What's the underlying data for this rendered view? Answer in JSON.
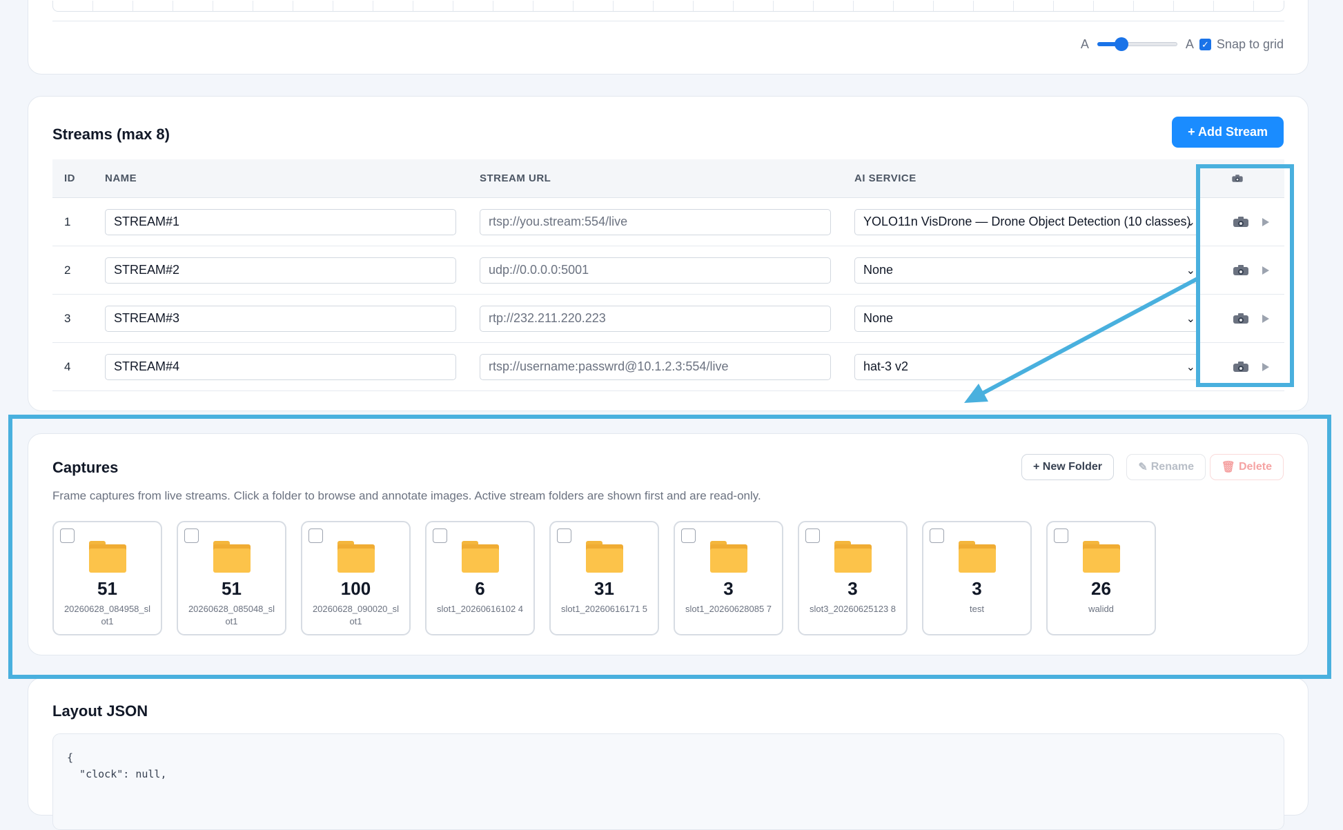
{
  "grid_controls": {
    "label_left": "A",
    "label_right": "A",
    "slider_level": 0.3,
    "snap_label": "Snap to grid",
    "snap_checked": true
  },
  "streams": {
    "title": "Streams (max 8)",
    "add_button": "+ Add Stream",
    "headers": {
      "id": "ID",
      "name": "NAME",
      "url": "STREAM URL",
      "ai": "AI SERVICE"
    },
    "rows": [
      {
        "id": "1",
        "name": "STREAM#1",
        "url": "rtsp://you.stream:554/live",
        "ai": "YOLO11n VisDrone — Drone Object Detection (10 classes)"
      },
      {
        "id": "2",
        "name": "STREAM#2",
        "url": "udp://0.0.0.0:5001",
        "ai": "None"
      },
      {
        "id": "3",
        "name": "STREAM#3",
        "url": "rtp://232.211.220.223",
        "ai": "None"
      },
      {
        "id": "4",
        "name": "STREAM#4",
        "url": "rtsp://username:passwrd@10.1.2.3:554/live",
        "ai": "hat-3 v2"
      }
    ]
  },
  "captures": {
    "title": "Captures",
    "description": "Frame captures from live streams. Click a folder to browse and annotate images. Active stream folders are shown first and are read-only.",
    "new_folder": "+ New Folder",
    "rename": "Rename",
    "delete": "Delete",
    "folders": [
      {
        "count": "51",
        "name": "20260628_084958_slot1"
      },
      {
        "count": "51",
        "name": "20260628_085048_slot1"
      },
      {
        "count": "100",
        "name": "20260628_090020_slot1"
      },
      {
        "count": "6",
        "name": "slot1_20260616102 4"
      },
      {
        "count": "31",
        "name": "slot1_20260616171 5"
      },
      {
        "count": "3",
        "name": "slot1_20260628085 7"
      },
      {
        "count": "3",
        "name": "slot3_20260625123 8"
      },
      {
        "count": "3",
        "name": "test"
      },
      {
        "count": "26",
        "name": "walidd"
      }
    ]
  },
  "layout_json": {
    "title": "Layout JSON",
    "code": "{\n  \"clock\": null,"
  },
  "colors": {
    "accent": "#1a73e8",
    "primary_button": "#1a8cff",
    "highlight": "#49b0de",
    "folder": "#fcc34a"
  },
  "icons": [
    "camera-icon",
    "play-icon",
    "folder-icon",
    "pencil-icon",
    "trash-icon",
    "checkbox-icon",
    "chevron-down-icon"
  ]
}
